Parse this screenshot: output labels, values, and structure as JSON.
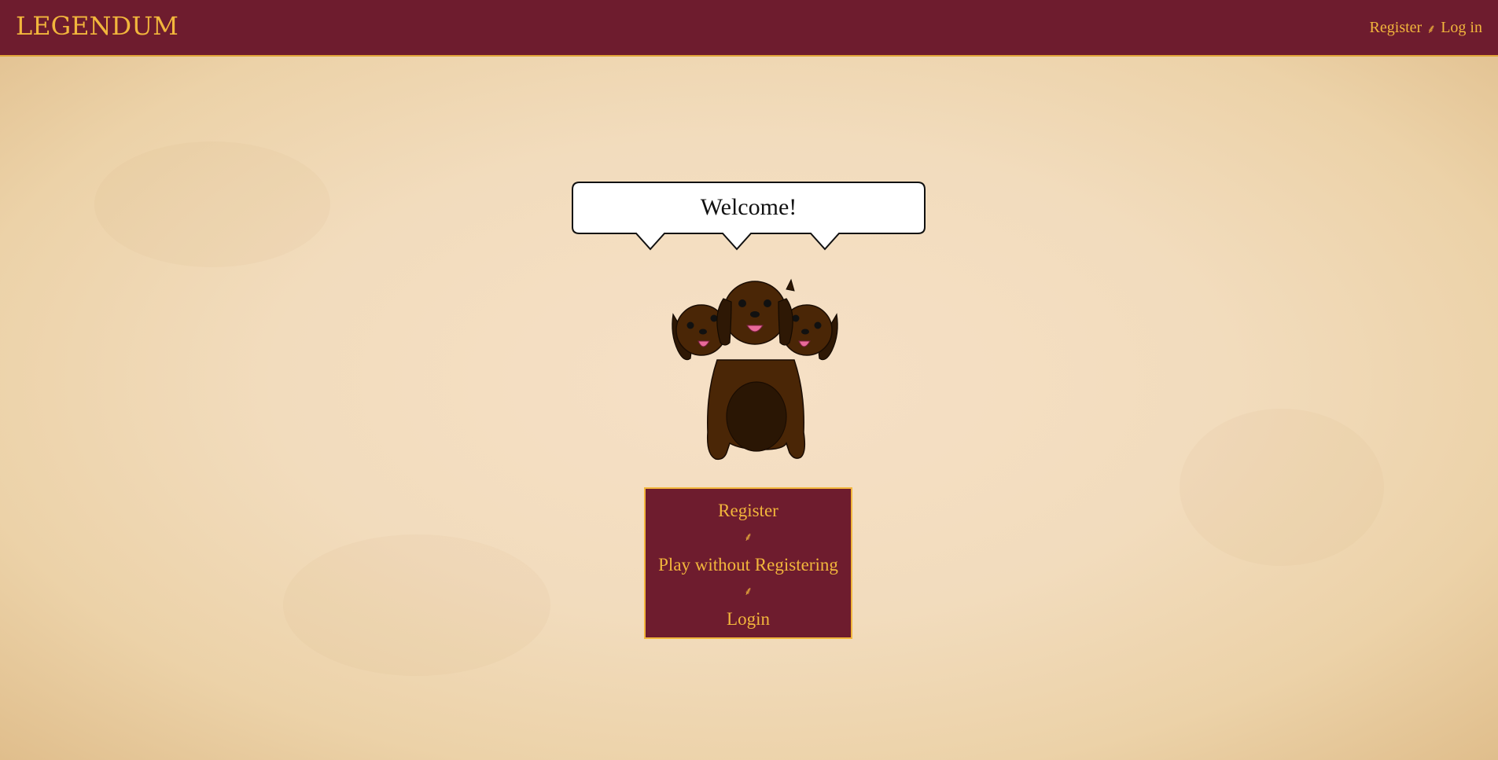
{
  "header": {
    "logo": "LEGENDUM",
    "nav": {
      "register": "Register",
      "separator": "⸙",
      "login": "Log in"
    }
  },
  "welcome": {
    "message": "Welcome!"
  },
  "mascot": {
    "icon": "three-headed-dog-icon"
  },
  "menu": {
    "register": "Register",
    "separator": "⸙",
    "play_without_registering": "Play without Registering",
    "login": "Login"
  },
  "colors": {
    "header_bg": "#6e1c2e",
    "accent_gold": "#f2b63c",
    "paper": "#f2dcbd"
  }
}
